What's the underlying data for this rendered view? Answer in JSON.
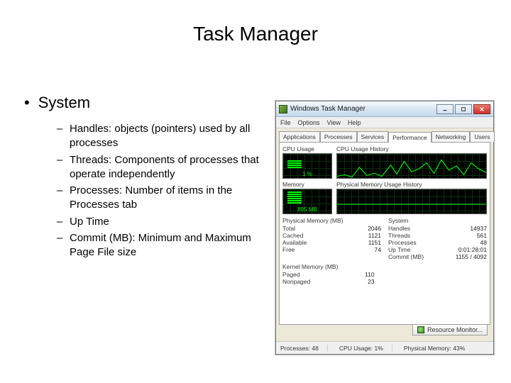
{
  "slide": {
    "title": "Task Manager",
    "heading": "System",
    "bullets": [
      "Handles: objects (pointers) used by all processes",
      "Threads: Components of processes that operate independently",
      "Processes: Number of items in the Processes tab",
      "Up Time",
      "Commit (MB): Minimum and Maximum Page File size"
    ]
  },
  "taskmgr": {
    "title": "Windows Task Manager",
    "menus": [
      "File",
      "Options",
      "View",
      "Help"
    ],
    "tabs": [
      "Applications",
      "Processes",
      "Services",
      "Performance",
      "Networking",
      "Users"
    ],
    "active_tab": "Performance",
    "panels": {
      "cpu_label": "CPU Usage",
      "cpu_hist_label": "CPU Usage History",
      "mem_label": "Memory",
      "mem_hist_label": "Physical Memory Usage History",
      "cpu_value": "1 %",
      "mem_value": "895 MB"
    },
    "phys_mem": {
      "title": "Physical Memory (MB)",
      "rows": [
        {
          "k": "Total",
          "v": "2046"
        },
        {
          "k": "Cached",
          "v": "1121"
        },
        {
          "k": "Available",
          "v": "1151"
        },
        {
          "k": "Free",
          "v": "74"
        }
      ]
    },
    "system": {
      "title": "System",
      "rows": [
        {
          "k": "Handles",
          "v": "14937"
        },
        {
          "k": "Threads",
          "v": "561"
        },
        {
          "k": "Processes",
          "v": "48"
        },
        {
          "k": "Up Time",
          "v": "0:01:28:01"
        },
        {
          "k": "Commit (MB)",
          "v": "1155 / 4092"
        }
      ]
    },
    "kernel": {
      "title": "Kernel Memory (MB)",
      "rows": [
        {
          "k": "Paged",
          "v": "110"
        },
        {
          "k": "Nonpaged",
          "v": "23"
        }
      ]
    },
    "resmon_label": "Resource Monitor...",
    "status": {
      "processes_label": "Processes:",
      "processes_value": "48",
      "cpu_label": "CPU Usage:",
      "cpu_value": "1%",
      "mem_label": "Physical Memory:",
      "mem_value": "43%"
    }
  }
}
